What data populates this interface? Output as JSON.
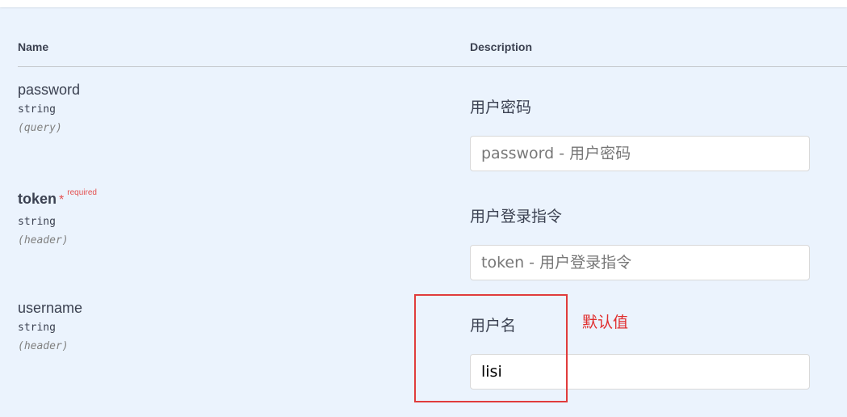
{
  "table": {
    "header": {
      "name": "Name",
      "description": "Description"
    },
    "params": [
      {
        "name": "password",
        "required": false,
        "type": "string",
        "location": "(query)",
        "description": "用户密码",
        "placeholder": "password - 用户密码",
        "value": ""
      },
      {
        "name": "token",
        "required": true,
        "required_marker": "*",
        "required_label": "required",
        "type": "string",
        "location": "(header)",
        "description": "用户登录指令",
        "placeholder": "token - 用户登录指令",
        "value": ""
      },
      {
        "name": "username",
        "required": false,
        "type": "string",
        "location": "(header)",
        "description": "用户名",
        "placeholder": "",
        "value": "lisi"
      }
    ]
  },
  "annotation": {
    "text": "默认值",
    "color": "#e02d2d"
  },
  "colors": {
    "background": "#ebf3fd",
    "text": "#3b4151",
    "required": "#e45050"
  }
}
